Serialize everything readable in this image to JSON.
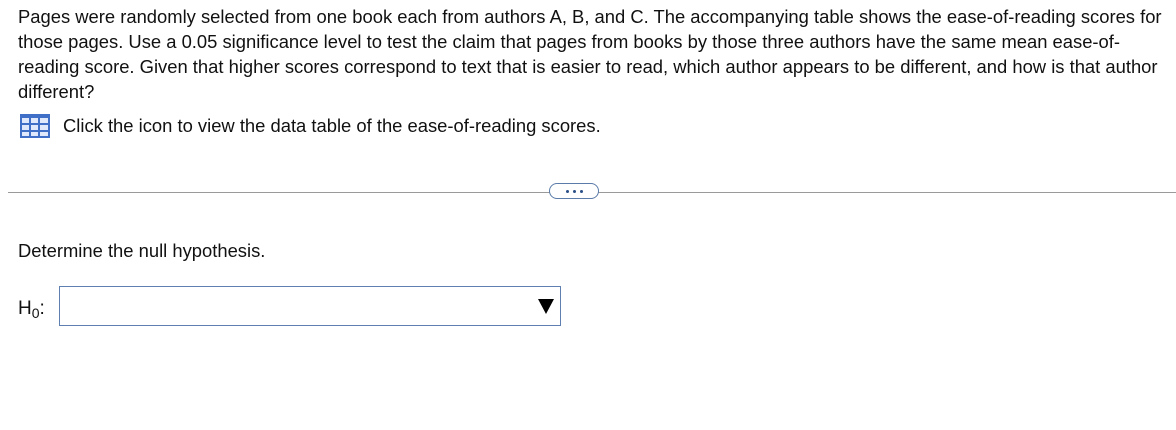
{
  "question": {
    "text": "Pages were randomly selected from one book each from authors A, B, and C. The accompanying table shows the ease-of-reading scores for those pages. Use a 0.05 significance level to test the claim that pages from books by those three authors have the same mean ease-of-reading score. Given that higher scores correspond to text that is easier to read, which author appears to be different, and how is that author different?"
  },
  "data_table_link": {
    "icon": "data-table-icon",
    "text": "Click the icon to view the data table of the ease-of-reading scores."
  },
  "more_button": {
    "icon": "ellipsis-icon"
  },
  "step": {
    "instruction": "Determine the null hypothesis.",
    "hypothesis_label_main": "H",
    "hypothesis_label_sub": "0",
    "hypothesis_label_colon": ":",
    "dropdown_selected": "",
    "dropdown_icon": "dropdown-arrow-icon"
  },
  "colors": {
    "table_icon_fill": "#3f6fc7",
    "table_icon_light": "#dfe9fb",
    "dropdown_border": "#5f7fb0",
    "divider": "#9a9a9a"
  }
}
